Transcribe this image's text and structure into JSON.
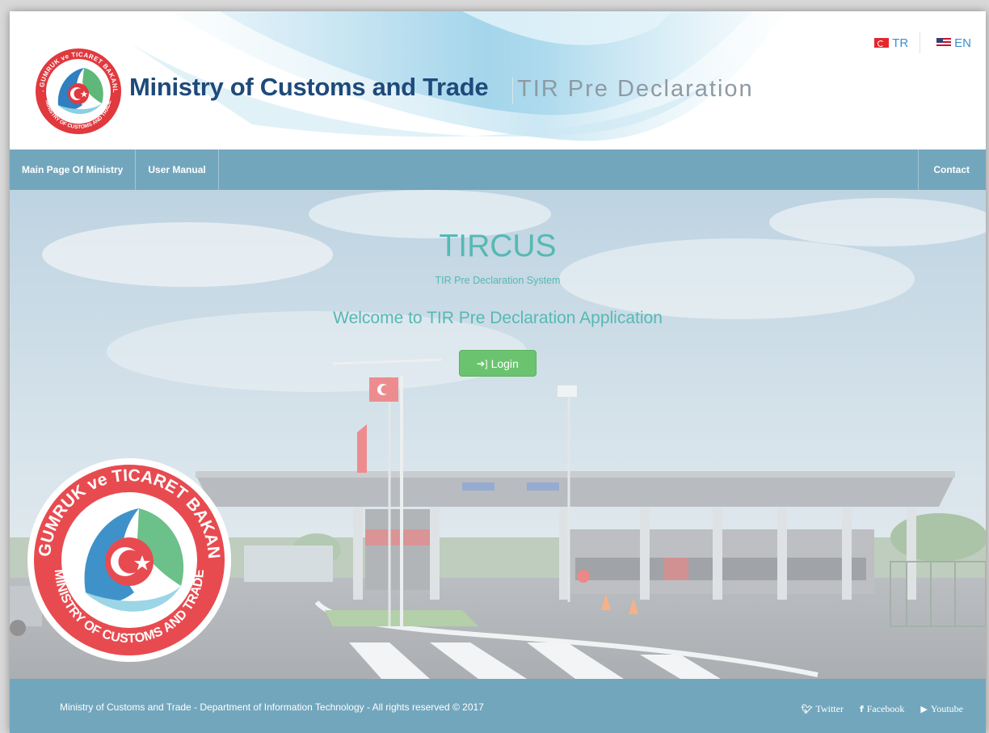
{
  "header": {
    "title": "Ministry of Customs and Trade",
    "subtitle": "TIR Pre Declaration",
    "seal_text_top": "T.C. GUMRUK ve TICARET BAKANLIGI",
    "seal_text_bottom": "MINISTRY OF CUSTOMS AND TRADE"
  },
  "languages": [
    {
      "code": "TR",
      "label": "TR",
      "icon": "turkey-flag-icon"
    },
    {
      "code": "EN",
      "label": "EN",
      "icon": "usa-flag-icon"
    }
  ],
  "nav": {
    "items": [
      {
        "label": "Main Page Of Ministry"
      },
      {
        "label": "User Manual"
      }
    ],
    "contact": "Contact"
  },
  "hero": {
    "title": "TIRCUS",
    "subtitle": "TIR Pre Declaration System",
    "welcome": "Welcome to TIR Pre Declaration Application",
    "login_label": "Login",
    "login_icon": "sign-in-icon"
  },
  "footer": {
    "copyright": "Ministry of Customs and Trade - Department of Information Technology - All rights reserved © 2017",
    "social": [
      {
        "label": "Twitter",
        "icon": "twitter-icon"
      },
      {
        "label": "Facebook",
        "icon": "facebook-icon"
      },
      {
        "label": "Youtube",
        "icon": "youtube-icon"
      }
    ]
  },
  "colors": {
    "nav_bar": "#72a6bd",
    "brand_title": "#1e4a7a",
    "hero_text": "#56b8b4",
    "login_button": "#6cc36f"
  }
}
